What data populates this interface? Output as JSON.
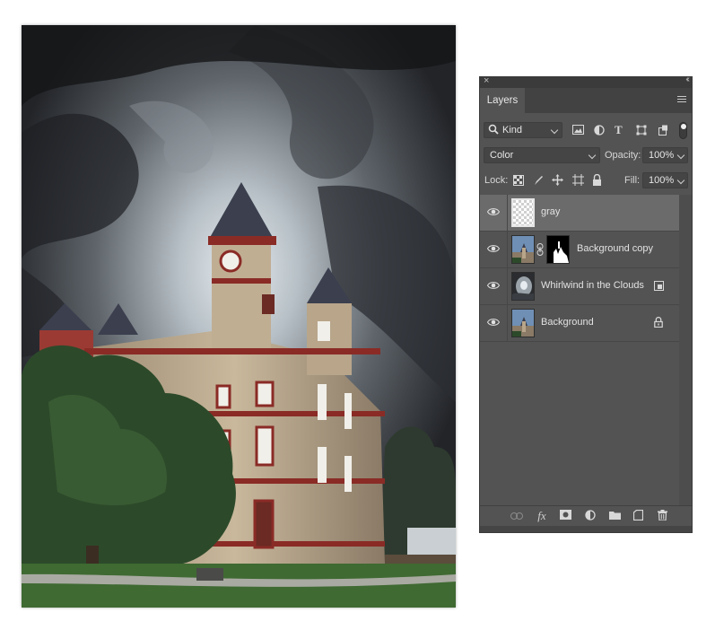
{
  "panel": {
    "tab_label": "Layers",
    "kind_filter": "Kind",
    "blend_mode": "Color",
    "opacity_label": "Opacity:",
    "opacity_value": "100%",
    "lock_label": "Lock:",
    "fill_label": "Fill:",
    "fill_value": "100%"
  },
  "layers": [
    {
      "name": "gray",
      "selected": true,
      "thumb": "transparent",
      "badge": "none"
    },
    {
      "name": "Background copy",
      "selected": false,
      "thumb": "photo",
      "badge": "mask-link"
    },
    {
      "name": "Whirlwind in the Clouds",
      "selected": false,
      "thumb": "clouds",
      "badge": "smart-object"
    },
    {
      "name": "Background",
      "selected": false,
      "thumb": "photo",
      "badge": "lock"
    }
  ],
  "colors": {
    "panel_bg": "#535353",
    "selected_row": "#6b6b6b",
    "sky_dark": "#2a2c2f",
    "sky_light": "#d6dce0",
    "building_stone": "#b8a58a",
    "building_trim": "#8a2b26",
    "roof": "#3b3f4e",
    "tree": "#2c4a2a",
    "grass": "#3f6a32"
  }
}
